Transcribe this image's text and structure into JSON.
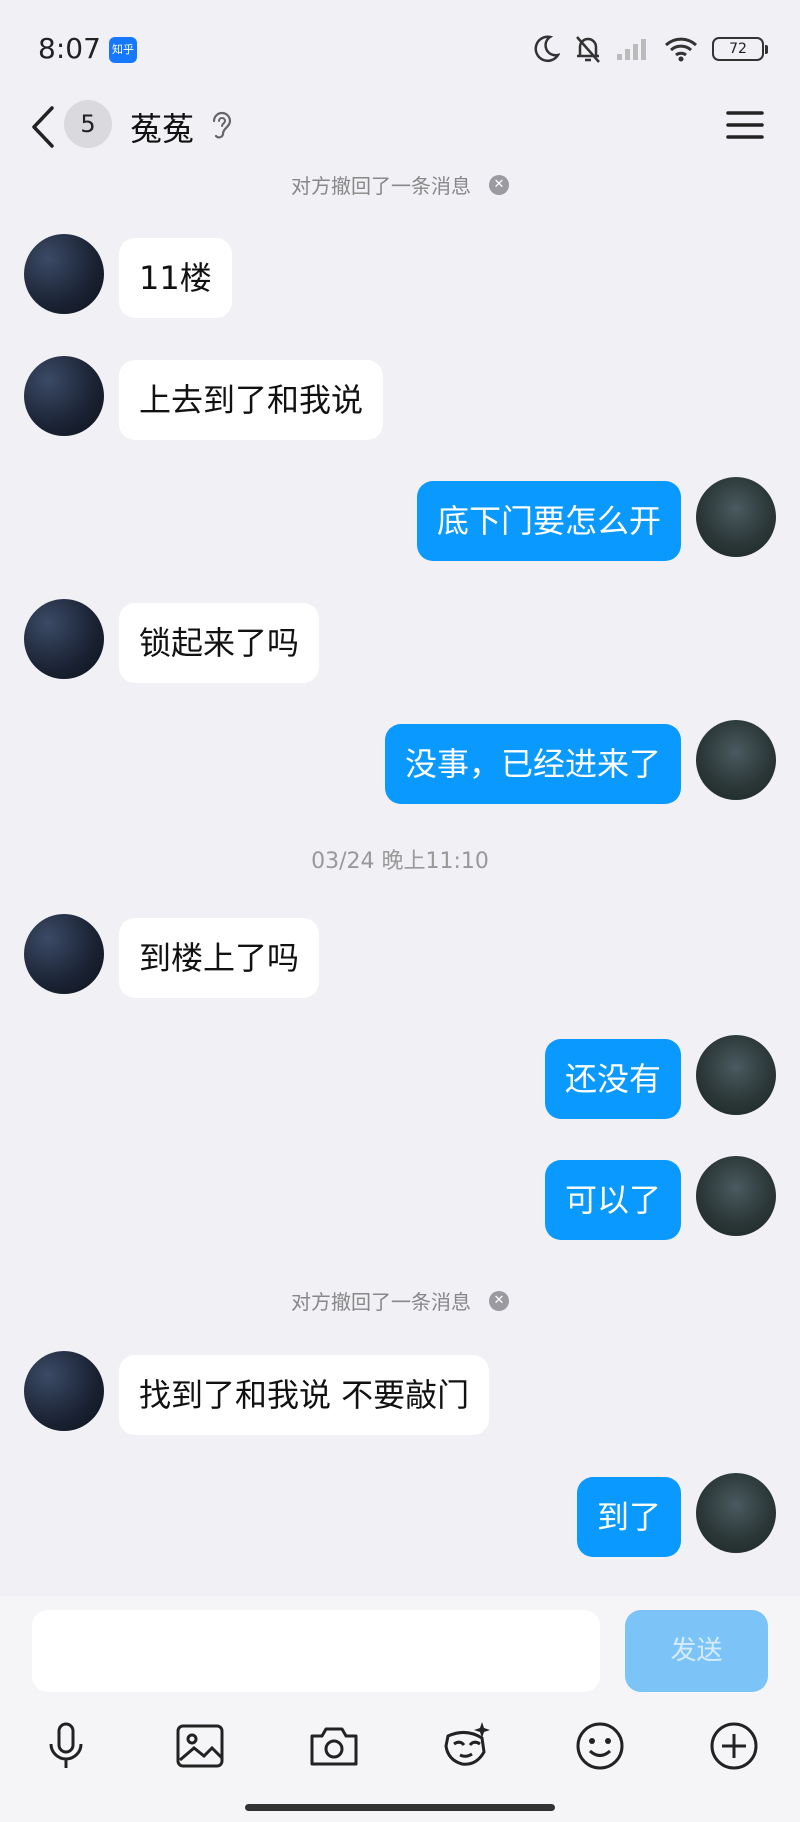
{
  "status": {
    "time": "8:07",
    "app_badge": "知乎",
    "battery": "72"
  },
  "header": {
    "unread_count": "5",
    "contact_name": "菟菟"
  },
  "recall_notice": "对方撤回了一条消息",
  "timestamp": "03/24 晚上11:10",
  "messages": [
    {
      "side": "in",
      "text": "11楼"
    },
    {
      "side": "in",
      "text": "上去到了和我说"
    },
    {
      "side": "out",
      "text": "底下门要怎么开"
    },
    {
      "side": "in",
      "text": "锁起来了吗"
    },
    {
      "side": "out",
      "text": "没事，已经进来了"
    },
    {
      "side": "in",
      "text": "到楼上了吗"
    },
    {
      "side": "out",
      "text": "还没有"
    },
    {
      "side": "out",
      "text": "可以了"
    },
    {
      "side": "in",
      "text": "找到了和我说 不要敲门"
    },
    {
      "side": "out",
      "text": "到了"
    }
  ],
  "input": {
    "value": "",
    "send_label": "发送"
  },
  "toolbar_icons": [
    "microphone-icon",
    "image-icon",
    "camera-icon",
    "sticker-icon",
    "emoji-icon",
    "plus-icon"
  ]
}
